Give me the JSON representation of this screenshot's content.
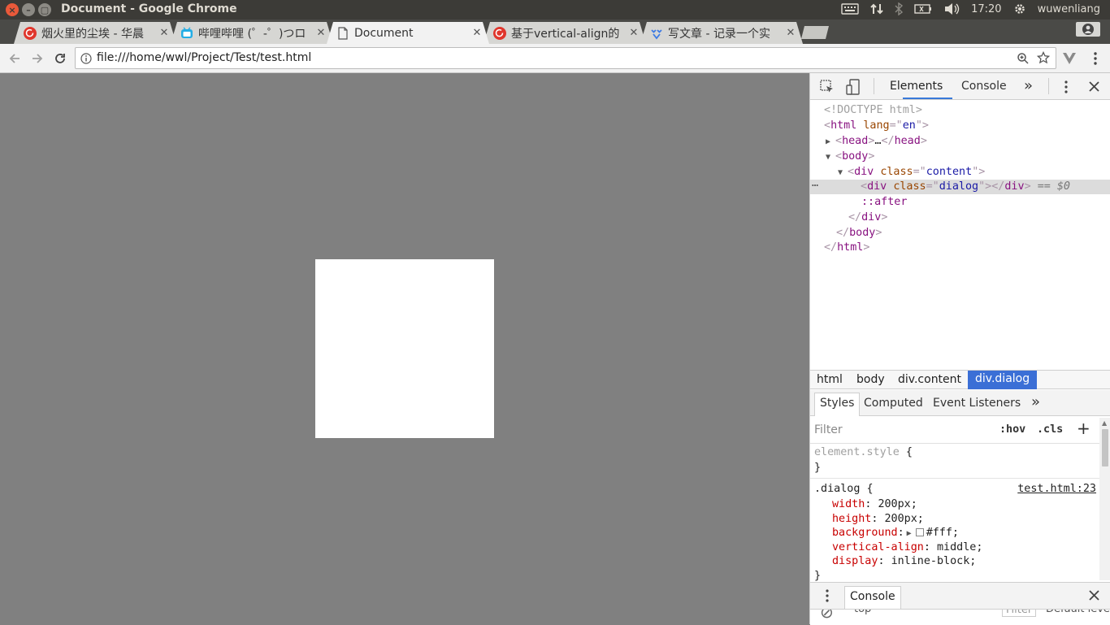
{
  "system": {
    "window_title": "Document - Google Chrome",
    "time": "17:20",
    "user": "wuwenliang"
  },
  "tabs": [
    {
      "label": "烟火里的尘埃 - 华晨",
      "icon": "netease-music-icon"
    },
    {
      "label": "哔哩哔哩 (゜-゜)つロ",
      "icon": "bilibili-icon"
    },
    {
      "label": "Document",
      "icon": "document-icon"
    },
    {
      "label": "基于vertical-align的",
      "icon": "netease-music-icon"
    },
    {
      "label": "写文章 - 记录一个实",
      "icon": "zhihu-icon"
    }
  ],
  "tab_close_glyph": "✕",
  "address": {
    "url": "file:///home/wwl/Project/Test/test.html"
  },
  "devtools": {
    "tabs": [
      "Elements",
      "Console"
    ],
    "more": "»",
    "dom": {
      "doctype": "<!DOCTYPE html>",
      "html_tag": "html",
      "lang_attr": "lang",
      "lang_val": "en",
      "head_tag": "head",
      "head_ellipsis": "…",
      "body_tag": "body",
      "div_tag": "div",
      "class_attr": "class",
      "content_val": "content",
      "dialog_val": "dialog",
      "selected_marker": "== $0",
      "dots": "…",
      "after": "::after"
    },
    "breadcrumbs": [
      "html",
      "body",
      "div.content",
      "div.dialog"
    ],
    "side_tabs": [
      "Styles",
      "Computed",
      "Event Listeners"
    ],
    "filter_placeholder": "Filter",
    "hov": ":hov",
    "cls": ".cls",
    "styles": {
      "element_style": "element.style",
      "selector": ".dialog",
      "source": "test.html:23",
      "props": [
        {
          "name": "width",
          "value": "200px;"
        },
        {
          "name": "height",
          "value": "200px;"
        },
        {
          "name": "background",
          "value": "#fff;"
        },
        {
          "name": "vertical-align",
          "value": "middle;"
        },
        {
          "name": "display",
          "value": "inline-block;"
        }
      ]
    },
    "drawer_tab": "Console",
    "drawer_context": "top",
    "drawer_filter": "Filter",
    "drawer_levels": "Default levels"
  },
  "colors": {
    "page_bg": "#808080",
    "dialog_bg": "#ffffff",
    "accent": "#3b6fd6"
  }
}
